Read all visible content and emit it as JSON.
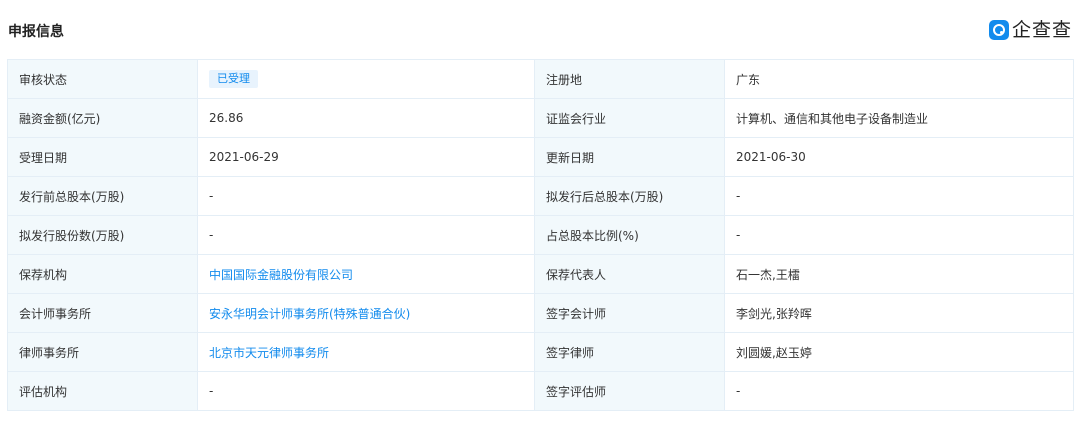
{
  "header": {
    "title": "申报信息",
    "brand": "企查查",
    "brand_icon": "qcc-logo-icon"
  },
  "colors": {
    "accent": "#128bed",
    "label_bg": "#f2f9fc",
    "border": "#e4eef6",
    "badge_bg": "#e8f3fd"
  },
  "rows": [
    {
      "l1": "审核状态",
      "v1": "已受理",
      "l2": "注册地",
      "v2": "广东"
    },
    {
      "l1": "融资金额(亿元)",
      "v1": "26.86",
      "l2": "证监会行业",
      "v2": "计算机、通信和其他电子设备制造业"
    },
    {
      "l1": "受理日期",
      "v1": "2021-06-29",
      "l2": "更新日期",
      "v2": "2021-06-30"
    },
    {
      "l1": "发行前总股本(万股)",
      "v1": "-",
      "l2": "拟发行后总股本(万股)",
      "v2": "-"
    },
    {
      "l1": "拟发行股份数(万股)",
      "v1": "-",
      "l2": "占总股本比例(%)",
      "v2": "-"
    },
    {
      "l1": "保荐机构",
      "v1": "中国国际金融股份有限公司",
      "l2": "保荐代表人",
      "v2": "石一杰,王檑"
    },
    {
      "l1": "会计师事务所",
      "v1": "安永华明会计师事务所(特殊普通合伙)",
      "l2": "签字会计师",
      "v2": "李剑光,张羚晖"
    },
    {
      "l1": "律师事务所",
      "v1": "北京市天元律师事务所",
      "l2": "签字律师",
      "v2": "刘圆媛,赵玉婷"
    },
    {
      "l1": "评估机构",
      "v1": "-",
      "l2": "签字评估师",
      "v2": "-"
    }
  ]
}
